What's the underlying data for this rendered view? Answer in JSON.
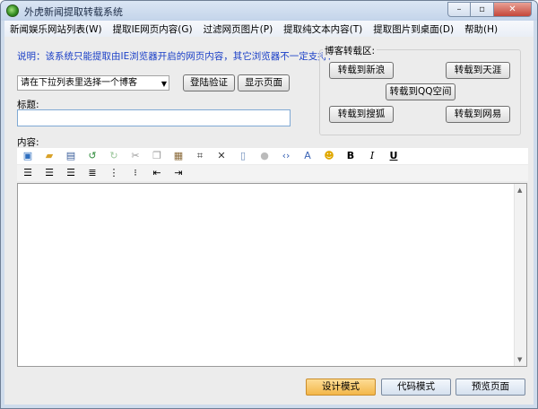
{
  "window": {
    "title": "外虎新闻提取转载系统"
  },
  "menu": [
    "新闻娱乐网站列表(W)",
    "提取IE网页内容(G)",
    "过滤网页图片(P)",
    "提取纯文本内容(T)",
    "提取图片到桌面(D)",
    "帮助(H)"
  ],
  "notice": "说明：该系统只能提取由IE浏览器开启的网页内容，其它浏览器不一定支持！",
  "blog_select": {
    "value": "请在下拉列表里选择一个博客"
  },
  "buttons": {
    "login_verify": "登陆验证",
    "show_page": "显示页面"
  },
  "labels": {
    "title": "标题:",
    "content": "内容:"
  },
  "reprint_group": {
    "title": "博客转载区:",
    "buttons": [
      "转载到新浪",
      "转载到天涯",
      "转载到QQ空间",
      "转载到搜狐",
      "转载到网易"
    ]
  },
  "format_toolbar": {
    "bold": "B",
    "italic": "I",
    "underline": "U"
  },
  "modes": {
    "design": "设计模式",
    "code": "代码模式",
    "preview": "预览页面"
  },
  "colors": {
    "accent_active": "#f3b74a",
    "notice_text": "#1a3fc7"
  }
}
